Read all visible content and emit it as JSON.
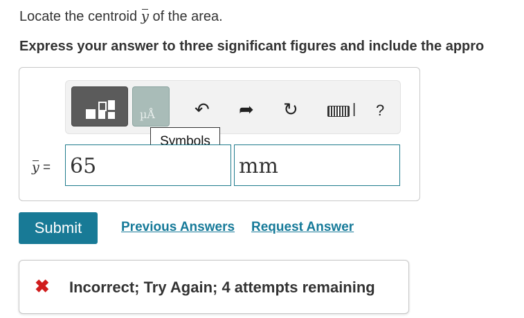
{
  "question": {
    "prompt_before": "Locate the centroid ",
    "variable": "y",
    "prompt_after": " of the area.",
    "instructions": "Express your answer to three significant figures and include the appro"
  },
  "toolbar": {
    "templates_icon": "templates-icon",
    "symbols_icon_text": "µÅ",
    "undo_icon": "undo-icon",
    "redo_icon": "redo-icon",
    "reset_icon": "reset-icon",
    "keyboard_icon": "keyboard-icon",
    "help_label": "?",
    "tooltip": "Symbols"
  },
  "answer": {
    "label_var": "y",
    "label_eq": " =",
    "value": "65",
    "units": "mm"
  },
  "actions": {
    "submit": "Submit",
    "previous_answers": "Previous Answers",
    "request_answer": "Request Answer"
  },
  "feedback": {
    "icon": "close-icon",
    "text": "Incorrect; Try Again; 4 attempts remaining"
  },
  "colors": {
    "accent": "#187a96",
    "link": "#167a99",
    "error": "#d01c1c"
  }
}
